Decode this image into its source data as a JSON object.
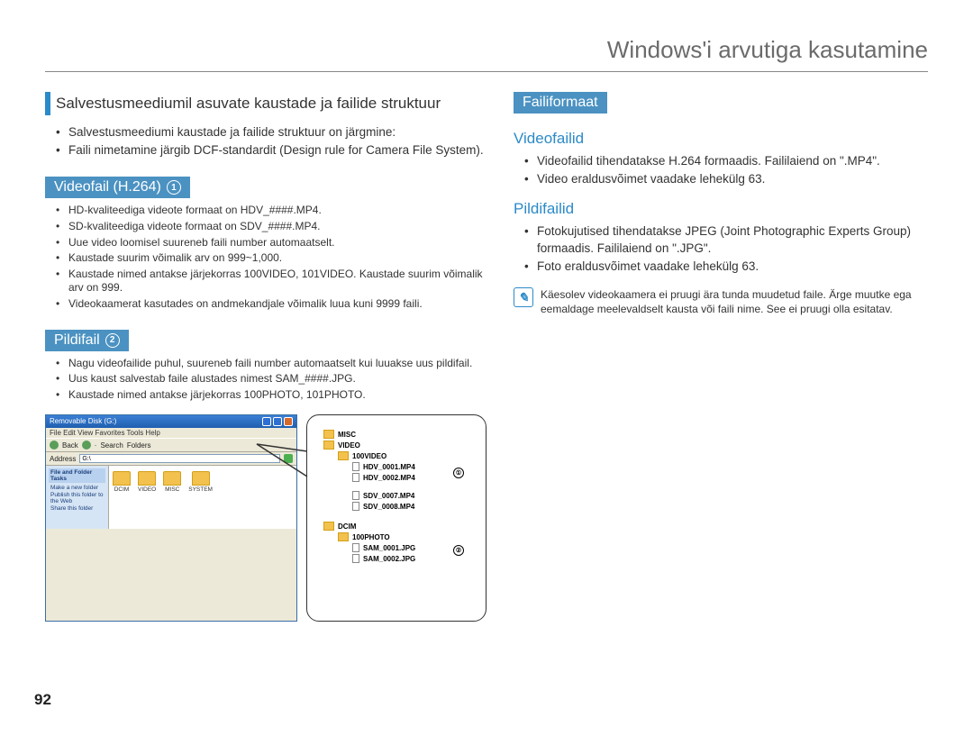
{
  "page_title": "Windows'i arvutiga kasutamine",
  "page_number": "92",
  "left": {
    "section_heading": "Salvestusmeediumil asuvate kaustade ja failide struktuur",
    "intro_bullets": [
      "Salvestusmeediumi kaustade ja failide struktuur on järgmine:",
      "Faili nimetamine järgib DCF-standardit (Design rule for Camera File System)."
    ],
    "videofail_heading": "Videofail (H.264)",
    "videofail_badge": "1",
    "videofail_bullets": [
      "HD-kvaliteediga videote formaat on HDV_####.MP4.",
      "SD-kvaliteediga videote formaat on SDV_####.MP4.",
      "Uue video loomisel suureneb faili number automaatselt.",
      "Kaustade suurim võimalik arv on 999~1,000.",
      "Kaustade nimed antakse järjekorras 100VIDEO, 101VIDEO. Kaustade suurim võimalik arv on 999.",
      "Videokaamerat kasutades on andmekandjale võimalik luua kuni 9999 faili."
    ],
    "pildifail_heading": "Pildifail",
    "pildifail_badge": "2",
    "pildifail_bullets": [
      "Nagu videofailide puhul, suureneb faili number automaatselt kui luuakse uus pildifail.",
      "Uus kaust salvestab faile alustades nimest SAM_####.JPG.",
      "Kaustade nimed antakse järjekorras 100PHOTO, 101PHOTO."
    ]
  },
  "right": {
    "failiformaat_heading": "Failiformaat",
    "videofailid_heading": "Videofailid",
    "videofailid_bullets": [
      "Videofailid tihendatakse H.264 formaadis. Faililaiend on \".MP4\".",
      "Video eraldusvõimet vaadake lehekülg 63."
    ],
    "pildifailid_heading": "Pildifailid",
    "pildifailid_bullets": [
      "Fotokujutised tihendatakse JPEG (Joint Photographic Experts Group) formaadis. Faililaiend on \".JPG\".",
      "Foto eraldusvõimet vaadake lehekülg 63."
    ],
    "note_text": "Käesolev videokaamera ei pruugi ära tunda muudetud faile. Ärge muutke ega eemaldage meelevaldselt kausta või faili nime. See ei pruugi olla esitatav."
  },
  "explorer": {
    "title": "Removable Disk (G:)",
    "menus": "File  Edit  View  Favorites  Tools  Help",
    "toolbar_back": "Back",
    "toolbar_search": "Search",
    "toolbar_folders": "Folders",
    "address_label": "Address",
    "address_value": "G:\\",
    "tasks_head": "File and Folder Tasks",
    "tasks_items": [
      "Make a new folder",
      "Publish this folder to the Web",
      "Share this folder"
    ],
    "folders": [
      "DCIM",
      "VIDEO",
      "MISC",
      "SYSTEM"
    ]
  },
  "tree": {
    "misc": "MISC",
    "video": "VIDEO",
    "v100": "100VIDEO",
    "hdv1": "HDV_0001.MP4",
    "hdv2": "HDV_0002.MP4",
    "sdv7": "SDV_0007.MP4",
    "sdv8": "SDV_0008.MP4",
    "dcim": "DCIM",
    "p100": "100PHOTO",
    "sam1": "SAM_0001.JPG",
    "sam2": "SAM_0002.JPG",
    "marker1": "①",
    "marker2": "②"
  }
}
